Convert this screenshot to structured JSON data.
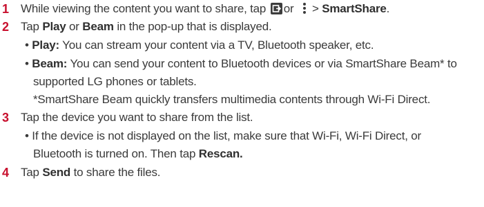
{
  "steps": [
    {
      "number": "1",
      "text_before": "While viewing the content you want to share, tap",
      "icon_share": "share-icon",
      "or_text": "or",
      "icon_menu": "menu-icon",
      "gt": ">",
      "bold": "SmartShare",
      "end": "."
    },
    {
      "number": "2",
      "pre": "Tap ",
      "bold1": "Play",
      "mid": " or ",
      "bold2": "Beam",
      "post": " in the pop-up that is displayed."
    },
    {
      "number": "3",
      "text": "Tap the device you want to share from the list."
    },
    {
      "number": "4",
      "pre": "Tap ",
      "bold": "Send",
      "post": " to share the files."
    }
  ],
  "bullets": {
    "play_label": "Play:",
    "play_text": " You can stream your content via a TV, Bluetooth speaker, etc.",
    "beam_label": "Beam:",
    "beam_text": " You can send your content to Bluetooth devices or via SmartShare Beam* to",
    "beam_cont": "supported LG phones or tablets.",
    "beam_note": "*SmartShare Beam quickly transfers multimedia contents through Wi-Fi Direct.",
    "device_text": "If the device is not displayed on the list, make sure that Wi-Fi, Wi-Fi Direct, or",
    "device_cont_pre": "Bluetooth is turned on. Then tap ",
    "device_cont_bold": "Rescan."
  },
  "bullet_char": "•",
  "colors": {
    "step_number": "#c8102e",
    "text": "#3a3a3a"
  }
}
